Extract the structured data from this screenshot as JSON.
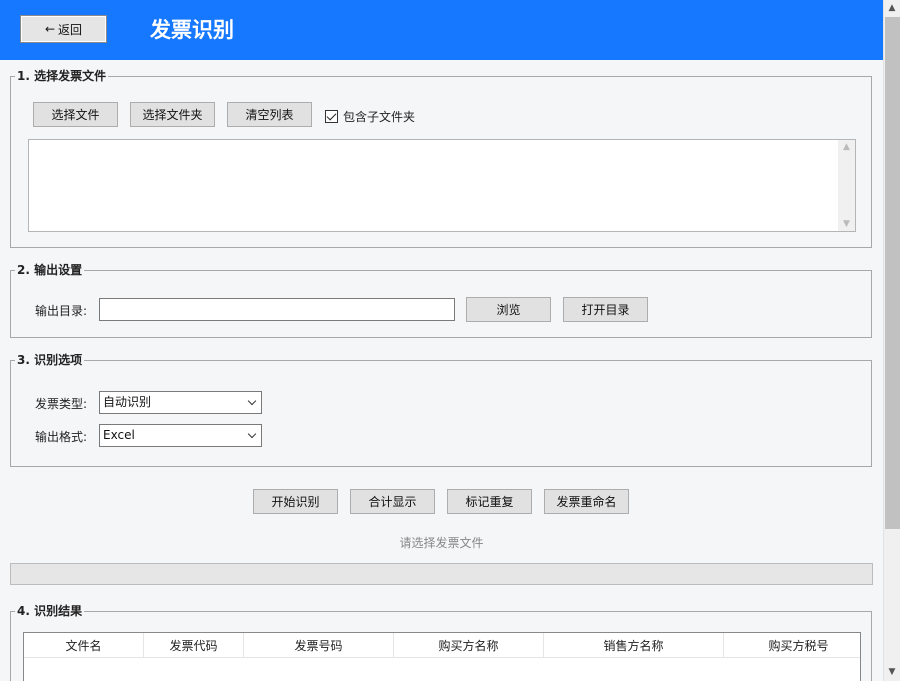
{
  "header": {
    "back_label": "返回",
    "title": "发票识别",
    "accent_color": "#1677ff"
  },
  "section1": {
    "legend": "1. 选择发票文件",
    "select_file_label": "选择文件",
    "select_folder_label": "选择文件夹",
    "clear_list_label": "清空列表",
    "include_subfolders_label": "包含子文件夹",
    "include_subfolders_checked": true
  },
  "section2": {
    "legend": "2. 输出设置",
    "output_dir_label": "输出目录:",
    "output_dir_value": "",
    "browse_label": "浏览",
    "open_dir_label": "打开目录"
  },
  "section3": {
    "legend": "3. 识别选项",
    "invoice_type_label": "发票类型:",
    "invoice_type_value": "自动识别",
    "output_format_label": "输出格式:",
    "output_format_value": "Excel"
  },
  "actions": {
    "start_label": "开始识别",
    "total_label": "合计显示",
    "mark_dup_label": "标记重复",
    "rename_label": "发票重命名"
  },
  "status": {
    "text": "请选择发票文件",
    "progress": 0
  },
  "section4": {
    "legend": "4. 识别结果",
    "columns": [
      "文件名",
      "发票代码",
      "发票号码",
      "购买方名称",
      "销售方名称",
      "购买方税号"
    ]
  }
}
